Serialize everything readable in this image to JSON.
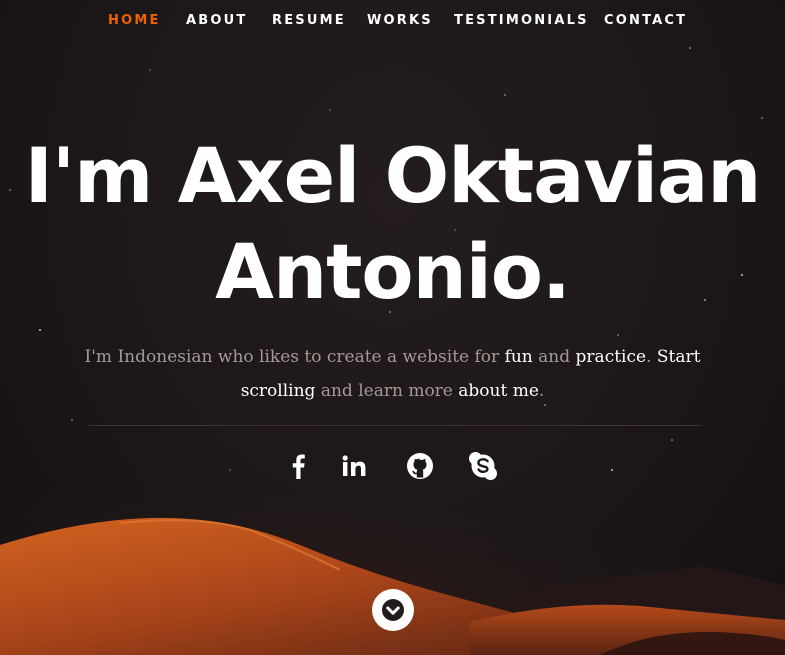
{
  "nav": {
    "items": [
      {
        "label": "HOME",
        "active": true
      },
      {
        "label": "ABOUT",
        "active": false
      },
      {
        "label": "RESUME",
        "active": false
      },
      {
        "label": "WORKS",
        "active": false
      },
      {
        "label": "TESTIMONIALS",
        "active": false
      },
      {
        "label": "CONTACT",
        "active": false
      }
    ],
    "active_color": "#f06000"
  },
  "hero": {
    "headline_line1": "I'm Axel Oktavian",
    "headline_line2": "Antonio.",
    "intro": {
      "part1": "I'm Indonesian who likes to create a website for ",
      "fun": "fun",
      "part2": " and ",
      "practice": "practice",
      "part3": ". ",
      "start_scrolling": "Start scrolling",
      "part4": " and learn more ",
      "about_me": "about me",
      "part5": "."
    }
  },
  "social": [
    {
      "icon": "facebook-icon"
    },
    {
      "icon": "linkedin-icon"
    },
    {
      "icon": "github-icon"
    },
    {
      "icon": "skype-icon"
    }
  ],
  "scroll_button": {
    "icon": "chevron-down-icon"
  },
  "colors": {
    "background": "#1c1718",
    "dune_orange": "#c4501c",
    "text_muted": "#a39b98"
  }
}
